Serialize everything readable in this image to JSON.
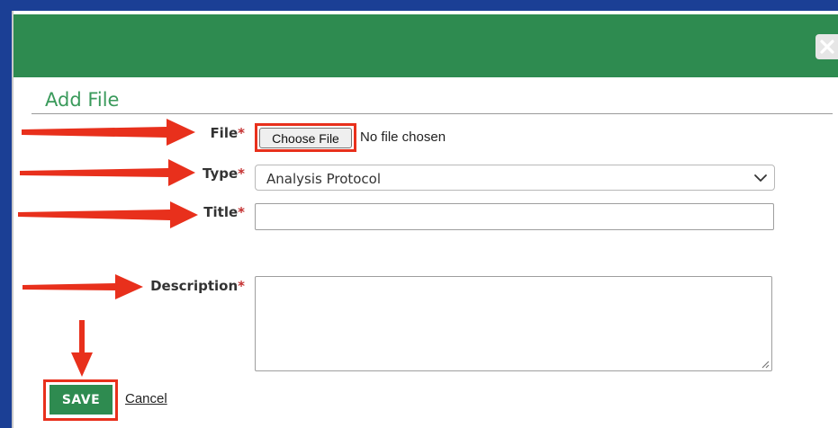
{
  "dialog": {
    "title": "Add File",
    "close_icon": "close-icon",
    "colors": {
      "header": "#2e8b50",
      "title": "#3a9a5b",
      "required": "#c43030",
      "highlight": "#e8301c",
      "frame": "#1b3f95"
    }
  },
  "form": {
    "file": {
      "label": "File",
      "required_mark": "*",
      "button_label": "Choose File",
      "status_text": "No file chosen"
    },
    "type": {
      "label": "Type",
      "required_mark": "*",
      "selected_value": "Analysis Protocol",
      "icon": "chevron-down-icon"
    },
    "title": {
      "label": "Title",
      "required_mark": "*",
      "value": ""
    },
    "description": {
      "label": "Description",
      "required_mark": "*",
      "value": ""
    }
  },
  "actions": {
    "save_label": "SAVE",
    "cancel_label": "Cancel"
  }
}
